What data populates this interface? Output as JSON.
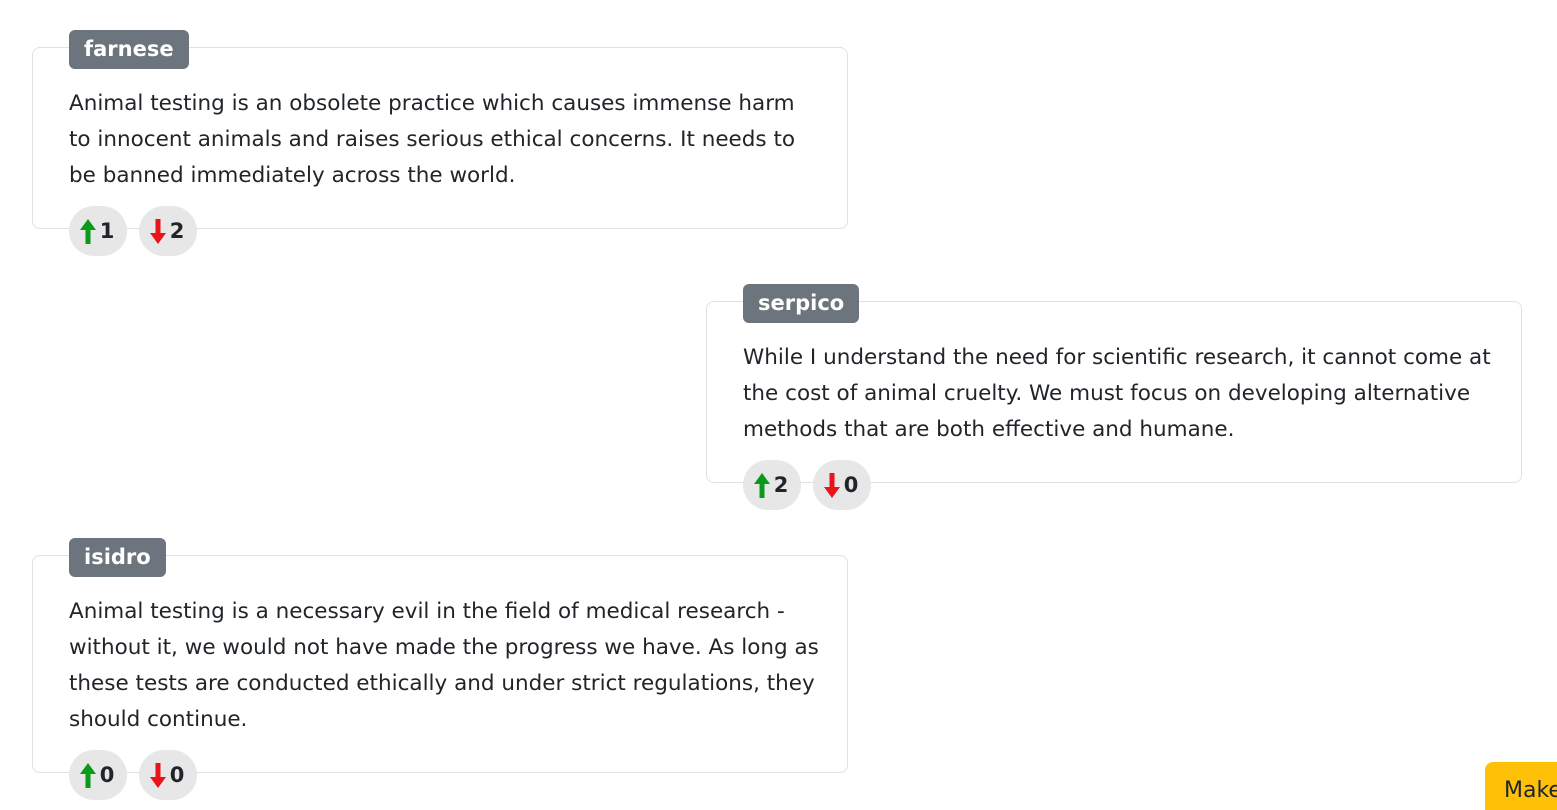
{
  "posts": [
    {
      "author": "farnese",
      "text": "Animal testing is an obsolete practice which causes immense harm to innocent animals and raises serious ethical concerns. It needs to be banned immediately across the world.",
      "upvotes": "1",
      "downvotes": "2"
    },
    {
      "author": "serpico",
      "text": "While I understand the need for scientific research, it cannot come at the cost of animal cruelty. We must focus on developing alternative methods that are both effective and humane.",
      "upvotes": "2",
      "downvotes": "0"
    },
    {
      "author": "isidro",
      "text": "Animal testing is a necessary evil in the field of medical research - without it, we would not have made the progress we have. As long as these tests are conducted ethically and under strict regulations, they should continue.",
      "upvotes": "0",
      "downvotes": "0"
    }
  ],
  "icons": {
    "upvote": "arrow-up-icon",
    "downvote": "arrow-down-icon"
  },
  "colors": {
    "upvote": "#0a9a1a",
    "downvote": "#e8141a",
    "author_badge": "#6c757d",
    "vote_button_bg": "#e7e7e7",
    "make_button_bg": "#ffc107"
  },
  "make_button": {
    "label": "Make"
  }
}
